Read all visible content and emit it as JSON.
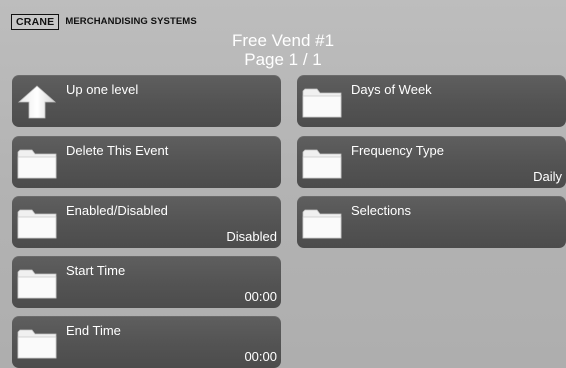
{
  "header": {
    "logo_brand": "CRANE",
    "logo_text": "MERCHANDISING SYSTEMS",
    "title": "Free Vend #1",
    "page": "Page 1 / 1"
  },
  "buttons": {
    "up": {
      "label": "Up one level",
      "icon": "up-arrow-icon"
    },
    "delete": {
      "label": "Delete This Event",
      "icon": "folder-icon"
    },
    "enabled": {
      "label": "Enabled/Disabled",
      "value": "Disabled",
      "icon": "folder-icon"
    },
    "start": {
      "label": "Start Time",
      "value": "00:00",
      "icon": "folder-icon"
    },
    "end": {
      "label": "End Time",
      "value": "00:00",
      "icon": "folder-icon"
    },
    "days": {
      "label": "Days of Week",
      "icon": "folder-icon"
    },
    "frequency": {
      "label": "Frequency Type",
      "value": "Daily",
      "icon": "folder-icon"
    },
    "selections": {
      "label": "Selections",
      "icon": "folder-icon"
    }
  },
  "colors": {
    "background": "#b4b4b4",
    "button": "#555555",
    "text": "#ffffff"
  }
}
